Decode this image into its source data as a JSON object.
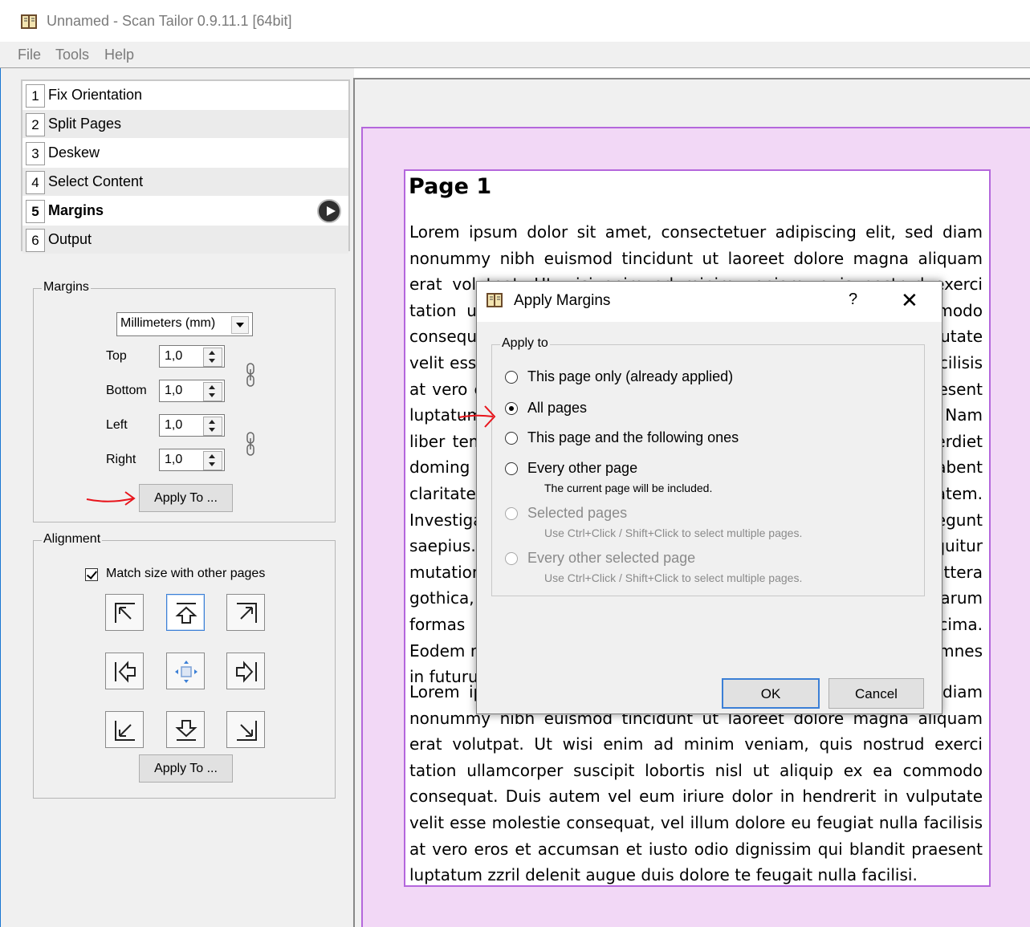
{
  "window": {
    "title": "Unnamed - Scan Tailor 0.9.11.1 [64bit]",
    "app_icon": "scan-tailor-app-icon"
  },
  "menu": [
    "File",
    "Tools",
    "Help"
  ],
  "stages": [
    {
      "num": "1",
      "label": "Fix Orientation"
    },
    {
      "num": "2",
      "label": "Split Pages"
    },
    {
      "num": "3",
      "label": "Deskew"
    },
    {
      "num": "4",
      "label": "Select Content"
    },
    {
      "num": "5",
      "label": "Margins"
    },
    {
      "num": "6",
      "label": "Output"
    }
  ],
  "margins": {
    "group_title": "Margins",
    "unit": "Millimeters (mm)",
    "fields": [
      {
        "label": "Top",
        "value": "1,0"
      },
      {
        "label": "Bottom",
        "value": "1,0"
      },
      {
        "label": "Left",
        "value": "1,0"
      },
      {
        "label": "Right",
        "value": "1,0"
      }
    ],
    "apply_to_label": "Apply To ..."
  },
  "alignment": {
    "group_title": "Alignment",
    "match_size_label": "Match size with other pages",
    "match_size_checked": true,
    "apply_to_label": "Apply To ..."
  },
  "page": {
    "heading": "Page 1",
    "paragraphs": [
      "Lorem ipsum dolor sit amet, consectetuer adipiscing elit, sed diam nonummy nibh euismod tincidunt ut laoreet dolore magna aliquam erat volutpat. Ut wisi enim ad minim veniam, quis nostrud exerci tation ullamcorper suscipit lobortis nisl ut aliquip ex ea commodo consequat. Duis autem vel eum iriure dolor in hendrerit in vulputate velit esse molestie consequat, vel illum dolore eu feugiat nulla facilisis at vero eros et accumsan et iusto odio dignissim qui blandit praesent luptatum zzril delenit augue duis dolore te feugait nulla facilisi. Nam liber tempor cum soluta nobis eleifend option congue nihil imperdiet doming id quod mazim placerat facer possim assum. Typi non habent claritatem insitam; est usus legentis in iis qui facit eorum claritatem. Investigationes demonstraverunt lectores legere me lius quod ii legunt saepius. Claritas est etiam processus dynamicus, qui sequitur mutationem consuetudium lectorum. Mirum est notare quam littera gothica, quam nunc putamus parum claram, anteposuerit litterarum formas humanitatis per seacula quarta decima et quinta decima. Eodem modo typi, qui nunc nobis videntur parum clari, fiant sollemnes in futurum.",
      "Lorem ipsum dolor sit amet, consectetuer adipiscing elit, sed diam nonummy nibh euismod tincidunt ut laoreet dolore magna aliquam erat volutpat. Ut wisi enim ad minim veniam, quis nostrud exerci tation ullamcorper suscipit lobortis nisl ut aliquip ex ea commodo consequat. Duis autem vel eum iriure dolor in hendrerit in vulputate velit esse molestie consequat, vel illum dolore eu feugiat nulla facilisis at vero eros et accumsan et iusto odio dignissim qui blandit praesent luptatum zzril delenit augue duis dolore te feugait nulla facilisi."
    ]
  },
  "dialog": {
    "title": "Apply Margins",
    "help": "?",
    "close": "✕",
    "group_title": "Apply to",
    "options": [
      {
        "label": "This page only (already applied)",
        "checked": false,
        "enabled": true,
        "hint": ""
      },
      {
        "label": "All pages",
        "checked": true,
        "enabled": true,
        "hint": ""
      },
      {
        "label": "This page and the following ones",
        "checked": false,
        "enabled": true,
        "hint": ""
      },
      {
        "label": "Every other page",
        "checked": false,
        "enabled": true,
        "hint": "The current page will be included."
      },
      {
        "label": "Selected pages",
        "checked": false,
        "enabled": false,
        "hint": "Use Ctrl+Click / Shift+Click to select multiple pages."
      },
      {
        "label": "Every other selected page",
        "checked": false,
        "enabled": false,
        "hint": "Use Ctrl+Click / Shift+Click to select multiple pages."
      }
    ],
    "ok_label": "OK",
    "cancel_label": "Cancel"
  },
  "colors": {
    "page_area": "#f2d8f6",
    "page_border": "#b467dc",
    "annotation_arrow": "#e8141b",
    "focus_blue": "#3b7fd6"
  }
}
